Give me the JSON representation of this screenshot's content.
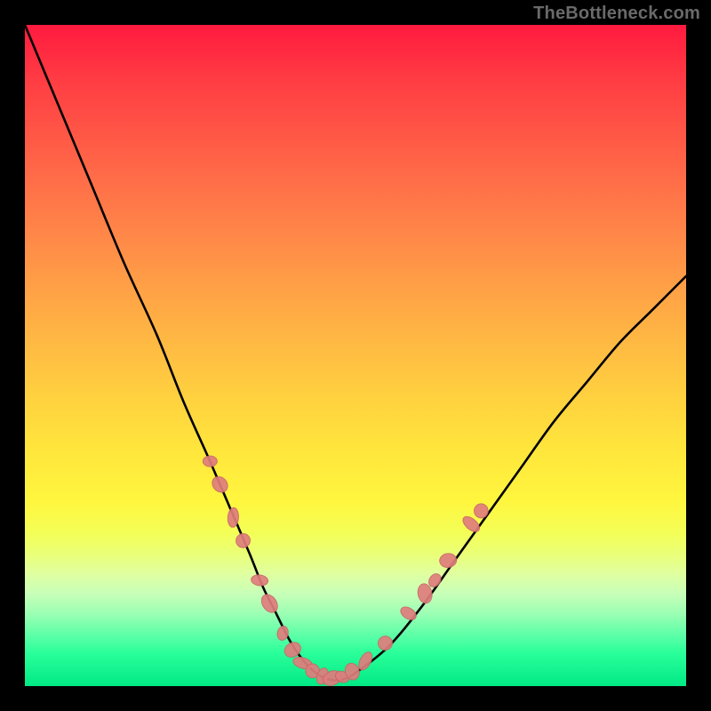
{
  "watermark": "TheBottleneck.com",
  "colors": {
    "frame": "#000000",
    "curve": "#000000",
    "marker_fill": "#e07d7d",
    "marker_stroke": "#c86868"
  },
  "chart_data": {
    "type": "line",
    "title": "",
    "xlabel": "",
    "ylabel": "",
    "xlim": [
      0,
      100
    ],
    "ylim": [
      0,
      100
    ],
    "grid": false,
    "legend": false,
    "series": [
      {
        "name": "curve",
        "x": [
          0,
          5,
          10,
          15,
          20,
          24,
          28,
          31,
          34,
          36,
          38,
          40,
          42,
          44,
          46,
          48,
          50,
          55,
          60,
          65,
          70,
          75,
          80,
          85,
          90,
          95,
          100
        ],
        "y": [
          100,
          88,
          76,
          64,
          53,
          43,
          34,
          27,
          20,
          15,
          11,
          7,
          4,
          2,
          1,
          1,
          2,
          6,
          12,
          19,
          26,
          33,
          40,
          46,
          52,
          57,
          62
        ]
      }
    ],
    "markers": [
      {
        "x": 28.0,
        "y": 34.0
      },
      {
        "x": 29.5,
        "y": 30.5
      },
      {
        "x": 31.5,
        "y": 25.5
      },
      {
        "x": 33.0,
        "y": 22.0
      },
      {
        "x": 35.5,
        "y": 16.0
      },
      {
        "x": 37.0,
        "y": 12.5
      },
      {
        "x": 39.0,
        "y": 8.0
      },
      {
        "x": 40.5,
        "y": 5.5
      },
      {
        "x": 42.0,
        "y": 3.5
      },
      {
        "x": 43.5,
        "y": 2.3
      },
      {
        "x": 45.0,
        "y": 1.5
      },
      {
        "x": 46.5,
        "y": 1.2
      },
      {
        "x": 48.0,
        "y": 1.4
      },
      {
        "x": 49.5,
        "y": 2.2
      },
      {
        "x": 51.5,
        "y": 3.8
      },
      {
        "x": 54.5,
        "y": 6.5
      },
      {
        "x": 58.0,
        "y": 11.0
      },
      {
        "x": 60.5,
        "y": 14.0
      },
      {
        "x": 62.0,
        "y": 16.0
      },
      {
        "x": 64.0,
        "y": 19.0
      },
      {
        "x": 67.5,
        "y": 24.5
      },
      {
        "x": 69.0,
        "y": 26.5
      }
    ]
  }
}
